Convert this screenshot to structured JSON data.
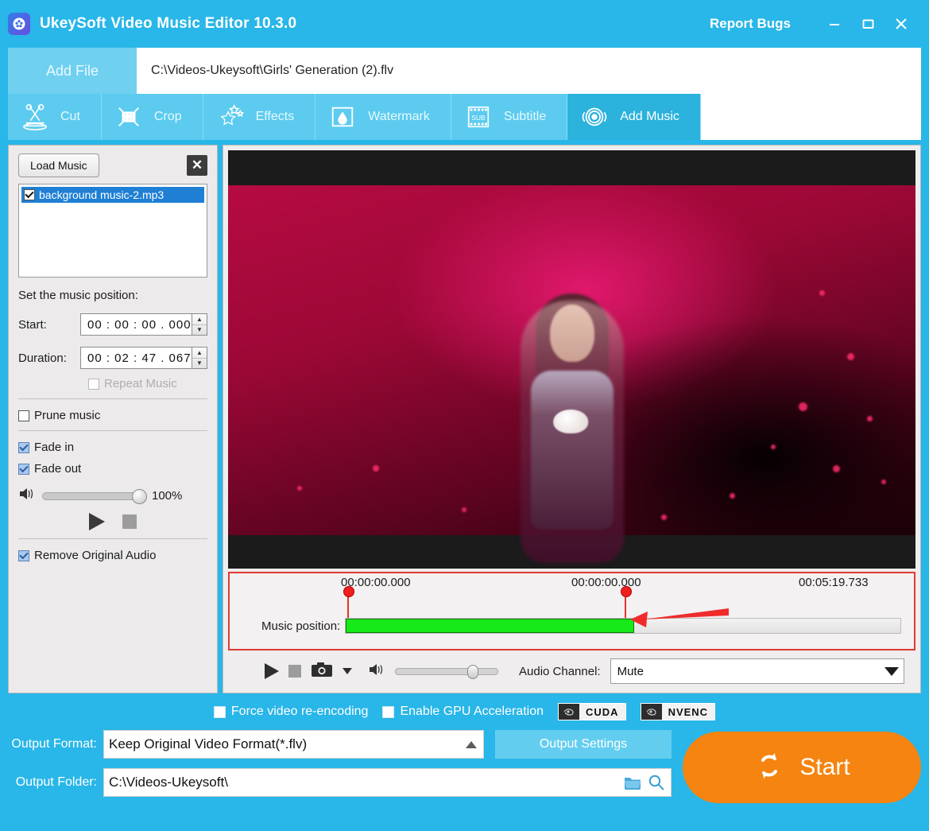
{
  "window": {
    "app_title": "UkeySoft Video Music Editor 10.3.0",
    "logo_icon": "film-reel-icon",
    "report_bugs": "Report Bugs",
    "minimize_icon": "minimize-icon",
    "maximize_icon": "maximize-icon",
    "close_icon": "close-icon",
    "accent_color": "#29b6e8"
  },
  "file_row": {
    "add_file_label": "Add File",
    "file_path": "C:\\Videos-Ukeysoft\\Girls' Generation (2).flv"
  },
  "tabs": [
    {
      "label": "Cut",
      "icon": "scissors-icon",
      "active": false
    },
    {
      "label": "Crop",
      "icon": "crop-grid-icon",
      "active": false
    },
    {
      "label": "Effects",
      "icon": "stars-icon",
      "active": false
    },
    {
      "label": "Watermark",
      "icon": "watermark-drop-icon",
      "active": false
    },
    {
      "label": "Subtitle",
      "icon": "subtitle-film-icon",
      "active": false
    },
    {
      "label": "Add Music",
      "icon": "music-target-icon",
      "active": true
    }
  ],
  "sidebar": {
    "load_music_label": "Load Music",
    "close_icon": "close-panel-icon",
    "music_items": [
      {
        "name": "background music-2.mp3",
        "checked": true,
        "selected": true
      }
    ],
    "position_label": "Set the music position:",
    "start_label": "Start:",
    "start_value": "00 : 00 : 00 . 000",
    "duration_label": "Duration:",
    "duration_value": "00 : 02 : 47 . 067",
    "repeat_music_label": "Repeat Music",
    "repeat_music_checked": false,
    "repeat_music_disabled": true,
    "prune_music_label": "Prune music",
    "prune_music_checked": false,
    "fade_in_label": "Fade in",
    "fade_in_checked": true,
    "fade_out_label": "Fade out",
    "fade_out_checked": true,
    "volume_icon": "speaker-icon",
    "volume_percent": "100%",
    "volume_value": 100,
    "play_icon": "play-icon",
    "stop_icon": "stop-icon",
    "remove_audio_label": "Remove Original Audio",
    "remove_audio_checked": true
  },
  "preview": {
    "timeline": {
      "time_start": "00:00:00.000",
      "time_marker": "00:00:00.000",
      "time_end": "00:05:19.733",
      "music_position_label": "Music position:",
      "fill_percent": 52,
      "fill_color": "#17e817",
      "highlight_color": "#e03a32",
      "annotation_arrow_icon": "red-arrow-icon"
    },
    "controls": {
      "play_icon": "play-icon",
      "stop_icon": "stop-icon",
      "snapshot_icon": "camera-icon",
      "snapshot_dropdown_icon": "caret-down-icon",
      "volume_icon": "speaker-icon",
      "volume_value": 70,
      "audio_channel_label": "Audio Channel:",
      "audio_channel_value": "Mute",
      "audio_channel_dropdown_icon": "chevron-down-icon"
    }
  },
  "bottom": {
    "force_reencoding_label": "Force video re-encoding",
    "force_reencoding_checked": false,
    "gpu_accel_label": "Enable GPU Acceleration",
    "gpu_accel_checked": false,
    "badges": [
      {
        "label": "CUDA",
        "icon": "nvidia-icon"
      },
      {
        "label": "NVENC",
        "icon": "nvidia-icon"
      }
    ],
    "output_format_label": "Output Format:",
    "output_format_value": "Keep Original Video Format(*.flv)",
    "output_format_dropdown_icon": "caret-up-icon",
    "output_settings_label": "Output Settings",
    "output_folder_label": "Output Folder:",
    "output_folder_value": "C:\\Videos-Ukeysoft\\",
    "folder_icon": "folder-open-icon",
    "search_icon": "magnifier-icon",
    "start_label": "Start",
    "start_icon": "refresh-cycle-icon",
    "start_color": "#f58410"
  }
}
